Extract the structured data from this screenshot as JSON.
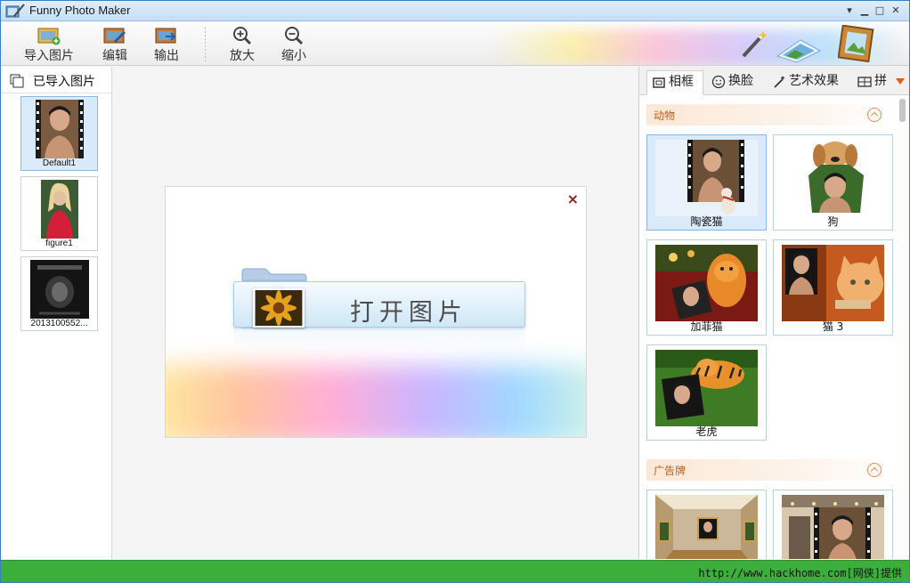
{
  "window": {
    "title": "Funny Photo Maker"
  },
  "toolbar": {
    "import_label": "导入图片",
    "edit_label": "编辑",
    "export_label": "输出",
    "zoom_in_label": "放大",
    "zoom_out_label": "缩小"
  },
  "left_panel": {
    "header": "已导入图片",
    "images": [
      {
        "caption": "Default1",
        "selected": true
      },
      {
        "caption": "figure1",
        "selected": false
      },
      {
        "caption": "2013100552...",
        "selected": false
      }
    ]
  },
  "dialog": {
    "open_label": "打开图片",
    "close_glyph": "×"
  },
  "right_panel": {
    "tabs": [
      {
        "label": "相框",
        "active": true
      },
      {
        "label": "换脸",
        "active": false
      },
      {
        "label": "艺术效果",
        "active": false
      },
      {
        "label": "拼",
        "active": false
      }
    ],
    "sections": [
      {
        "title": "动物",
        "items": [
          {
            "caption": "陶瓷猫",
            "selected": true
          },
          {
            "caption": "狗",
            "selected": false
          },
          {
            "caption": "加菲猫",
            "selected": false
          },
          {
            "caption": "猫 3",
            "selected": false
          },
          {
            "caption": "老虎",
            "selected": false
          }
        ]
      },
      {
        "title": "广告牌",
        "items": []
      }
    ]
  },
  "statusbar": {
    "text": "http://www.hackhome.com[网侠]提供"
  },
  "colors": {
    "accent_blue": "#3c7fc0",
    "status_green": "#3cae3c",
    "section_text": "#c25e1c"
  }
}
